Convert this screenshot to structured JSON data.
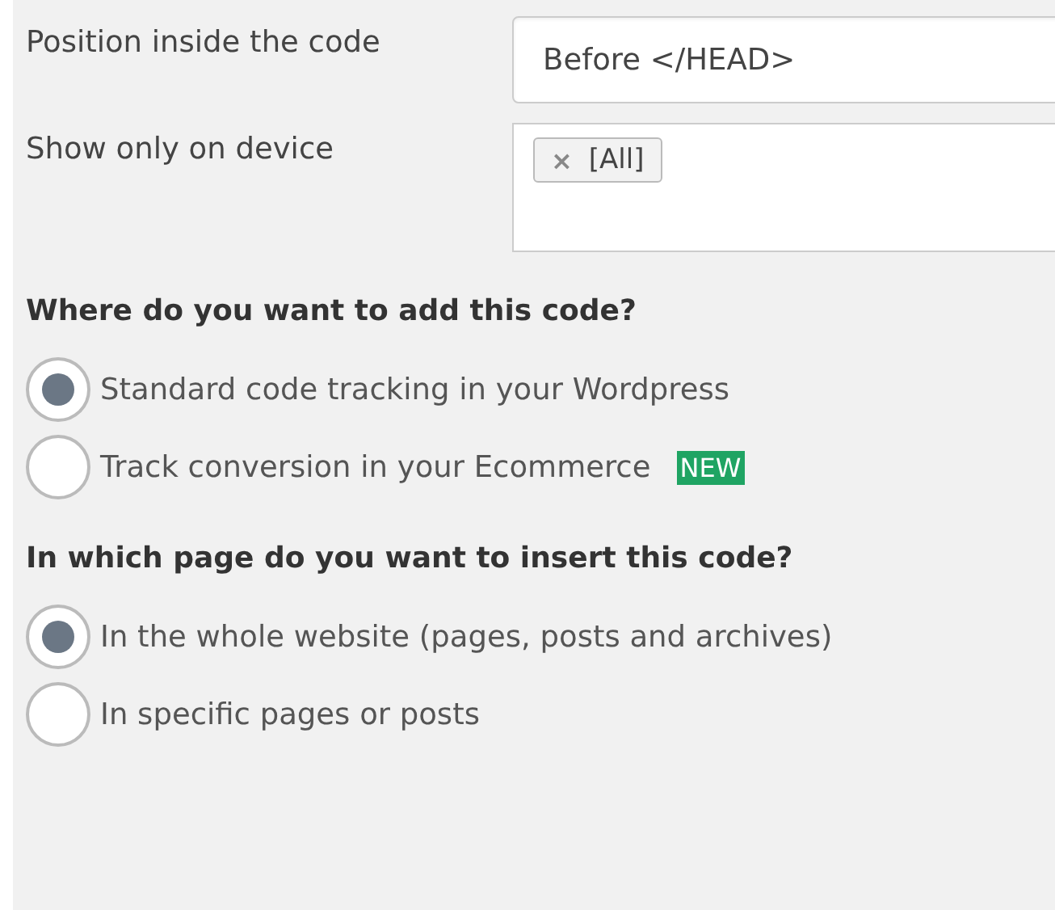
{
  "settings": [
    {
      "label": "Position inside the code",
      "kind": "select",
      "value": "Before </HEAD>"
    },
    {
      "label": "Show only on device",
      "kind": "tags",
      "tags": [
        {
          "remove": "×",
          "label": "[All]"
        }
      ]
    }
  ],
  "sections": [
    {
      "heading": "Where do you want to add this code?",
      "options": [
        {
          "label": "Standard code tracking in your Wordpress",
          "selected": true
        },
        {
          "label": "Track conversion in your Ecommerce",
          "selected": false,
          "badge": "NEW"
        }
      ]
    },
    {
      "heading": "In which page do you want to insert this code?",
      "options": [
        {
          "label": "In the whole website (pages, posts and archives)",
          "selected": true
        },
        {
          "label": "In specific pages or posts",
          "selected": false
        }
      ]
    }
  ]
}
